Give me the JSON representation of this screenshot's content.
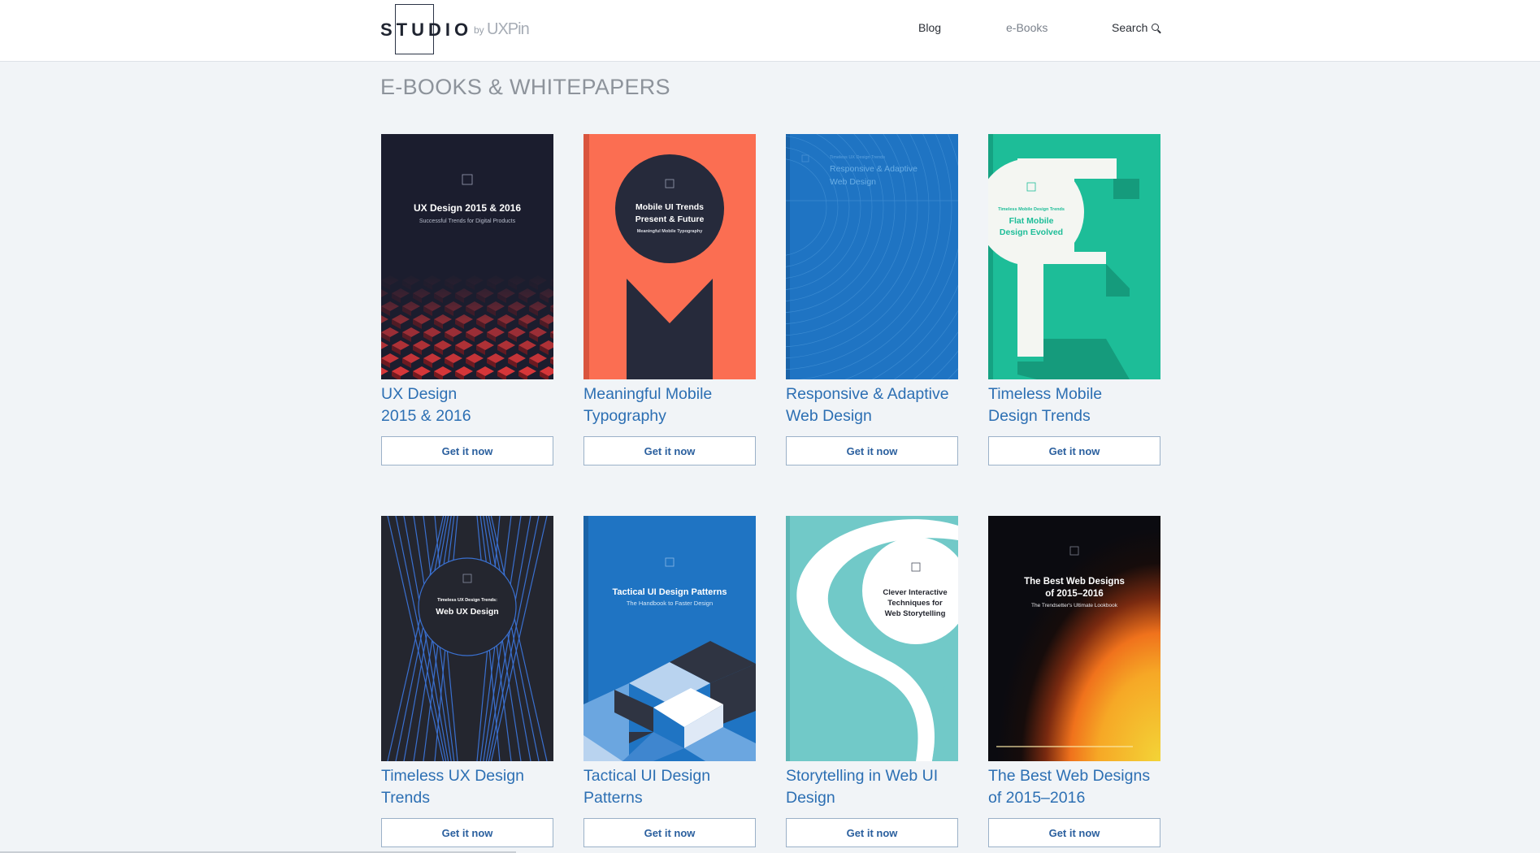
{
  "header": {
    "logo_word": "STUDIO",
    "logo_by": "by",
    "logo_brand": "UXPin",
    "nav": {
      "blog": "Blog",
      "ebooks": "e-Books",
      "search": "Search"
    }
  },
  "page_title": "E-BOOKS & WHITEPAPERS",
  "cta_label": "Get it now",
  "books": [
    {
      "title_line1": "UX Design",
      "title_line2": "2015 & 2016",
      "cover_title": "UX Design 2015 & 2016",
      "cover_subtitle": "Successful Trends for Digital Products"
    },
    {
      "title_line1": "Meaningful Mobile",
      "title_line2": "Typography",
      "cover_title_1": "Mobile UI Trends",
      "cover_title_2": "Present & Future",
      "cover_subtitle": "Meaningful Mobile Typography"
    },
    {
      "title_line1": "Responsive & Adaptive",
      "title_line2": "Web Design",
      "cover_kicker": "Timeless UX Design Trends",
      "cover_title_1": "Responsive & Adaptive",
      "cover_title_2": "Web Design"
    },
    {
      "title_line1": "Timeless Mobile",
      "title_line2": "Design Trends",
      "cover_kicker": "Timeless Mobile Design Trends",
      "cover_title_1": "Flat Mobile",
      "cover_title_2": "Design Evolved"
    },
    {
      "title_line1": "Timeless UX Design",
      "title_line2": "Trends",
      "cover_kicker": "Timeless UX Design Trends:",
      "cover_title": "Web UX Design"
    },
    {
      "title_line1": "Tactical UI Design",
      "title_line2": "Patterns",
      "cover_title": "Tactical UI Design Patterns",
      "cover_subtitle": "The Handbook to Faster Design"
    },
    {
      "title_line1": "Storytelling in Web UI",
      "title_line2": "Design",
      "cover_title_1": "Clever Interactive",
      "cover_title_2": "Techniques for",
      "cover_title_3": "Web Storytelling"
    },
    {
      "title_line1": "The Best Web Designs",
      "title_line2": "of 2015–2016",
      "cover_title_1": "The Best Web Designs",
      "cover_title_2": "of 2015–2016",
      "cover_subtitle": "The Trendsetter's Ultimate Lookbook"
    }
  ],
  "colors": {
    "link": "#2c6fb3",
    "page_bg": "#f1f4f7",
    "cover_dark": "#1b1d2e",
    "cover_orange": "#fb6e52",
    "cover_blue": "#1f74c3",
    "cover_green": "#1dbd98",
    "cover_teal": "#71c9c8"
  }
}
